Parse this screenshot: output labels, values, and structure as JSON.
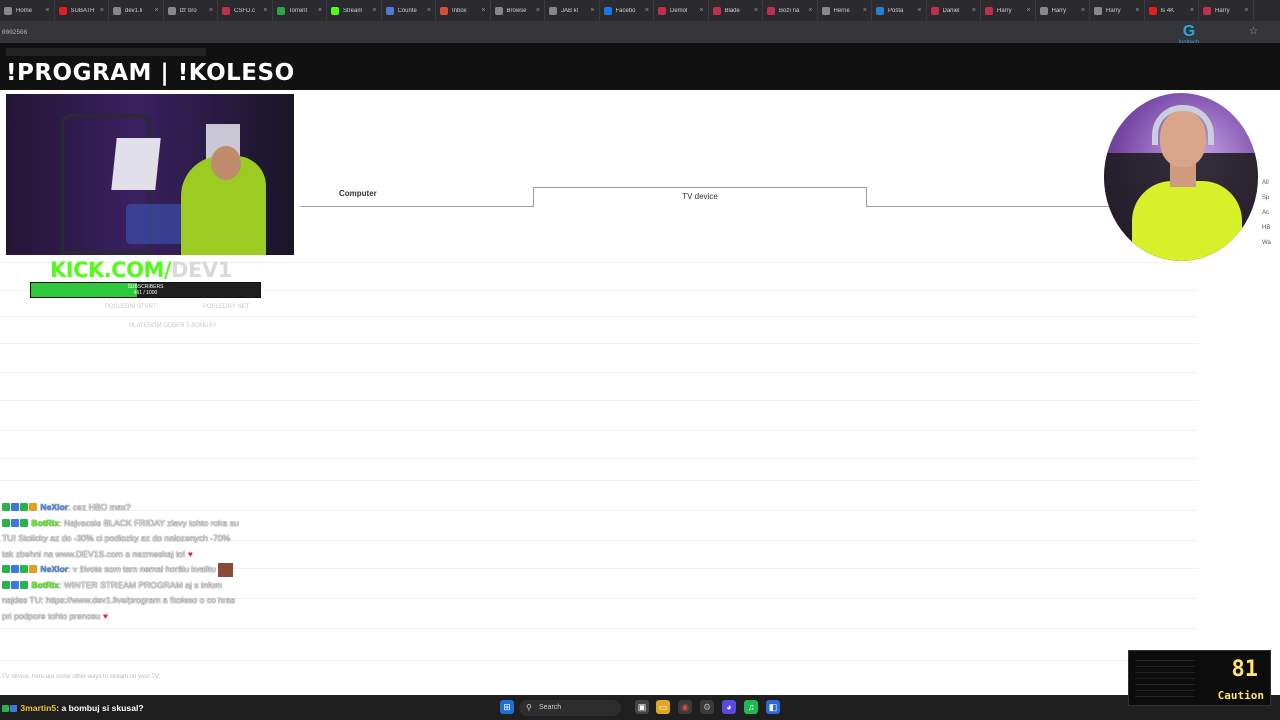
{
  "browser": {
    "tabs": [
      {
        "label": "Home",
        "color": "#888888"
      },
      {
        "label": "SUBATH",
        "color": "#e02020"
      },
      {
        "label": "dev1.li",
        "color": "#888888"
      },
      {
        "label": "Ižť bro",
        "color": "#888888"
      },
      {
        "label": "ČSFD.c",
        "color": "#c0304a"
      },
      {
        "label": "Torrent",
        "color": "#2aa848"
      },
      {
        "label": "Stream",
        "color": "#53fc18"
      },
      {
        "label": "Counte",
        "color": "#4a7ad8"
      },
      {
        "label": "Inbox",
        "color": "#d84a3a"
      },
      {
        "label": "Browse",
        "color": "#888888"
      },
      {
        "label": "JAB kl",
        "color": "#888888"
      },
      {
        "label": "Facebo",
        "color": "#1877f2"
      },
      {
        "label": "Demol",
        "color": "#c0304a"
      },
      {
        "label": "Blade",
        "color": "#c0304a"
      },
      {
        "label": "Boží ná",
        "color": "#c0304a"
      },
      {
        "label": "Herné",
        "color": "#888888"
      },
      {
        "label": "Pošta",
        "color": "#2a7ad8"
      },
      {
        "label": "Daniel",
        "color": "#c0304a"
      },
      {
        "label": "Harry",
        "color": "#c0304a"
      },
      {
        "label": "Harry",
        "color": "#888888"
      },
      {
        "label": "Harry",
        "color": "#888888"
      },
      {
        "label": "Is 4K",
        "color": "#e02020"
      },
      {
        "label": "Harry",
        "color": "#c0304a"
      }
    ],
    "tab_close": "×",
    "url": "0002506",
    "bookmark_icon": "☆",
    "logitech_label": "logitech"
  },
  "overlay": {
    "title": "!PROGRAM | !KOLESO",
    "kick_text": "KICK.COM/",
    "kick_channel": "DEV1",
    "subscribers_label": "SUBSCRIBERS",
    "subscribers_count": "461 / 1000",
    "subscribers_progress": 0.461,
    "faint_text_1": "POSLEDNÍ ŠTVRT",
    "faint_text_2": "POSLEDNÝ NET",
    "faint_text_3": "PLATENOM ODBER 5 BONUSY"
  },
  "page": {
    "tab_computer": "Computer",
    "tab_tv": "TV device",
    "sidebar": [
      "All",
      "Sp",
      "Ac",
      "HB",
      "Wa"
    ]
  },
  "chat": {
    "messages": [
      {
        "user": "NeXlor",
        "user_color": "#4a8ef0",
        "text": ": cez HBO max?",
        "badges": [
          "#2ab34a",
          "#3a7ae0",
          "#2ab34a",
          "#e0a020"
        ]
      },
      {
        "user": "BotRix",
        "user_color": "#53fc18",
        "text": ": Najvacsie BLACK FRIDAY zlavy tohto roka su TU! Stolicky az do -30% ci podlozky az do nalozenych -70% tak zbehni na www.DEV1S.com a nezmeskaj to!",
        "badges": [
          "#2ab34a",
          "#3a7ae0",
          "#2ab34a"
        ],
        "heart": "♥"
      },
      {
        "user": "NeXlor",
        "user_color": "#4a8ef0",
        "text": ": v živote som tam nemal horšiu kvalitu",
        "badges": [
          "#2ab34a",
          "#3a7ae0",
          "#2ab34a",
          "#e0a020"
        ],
        "emote": true
      },
      {
        "user": "BotRix",
        "user_color": "#53fc18",
        "text": ": WINTER STREAM PROGRAM aj s infom najdes TU: https://www.dev1.live/program a !koleso o co hras pri podpore tohto prenosu",
        "badges": [
          "#2ab34a",
          "#3a7ae0",
          "#2ab34a"
        ],
        "heart": "♥"
      }
    ],
    "last_message": {
      "user": "3martin5",
      "text": ": a bombuj si skusal?"
    },
    "overlap_text": "TV device, here are some other ways to stream on your TV:"
  },
  "taskbar": {
    "search_label": "Search",
    "search_icon": "search-icon"
  },
  "widget": {
    "value": "81",
    "label": "Caution"
  }
}
